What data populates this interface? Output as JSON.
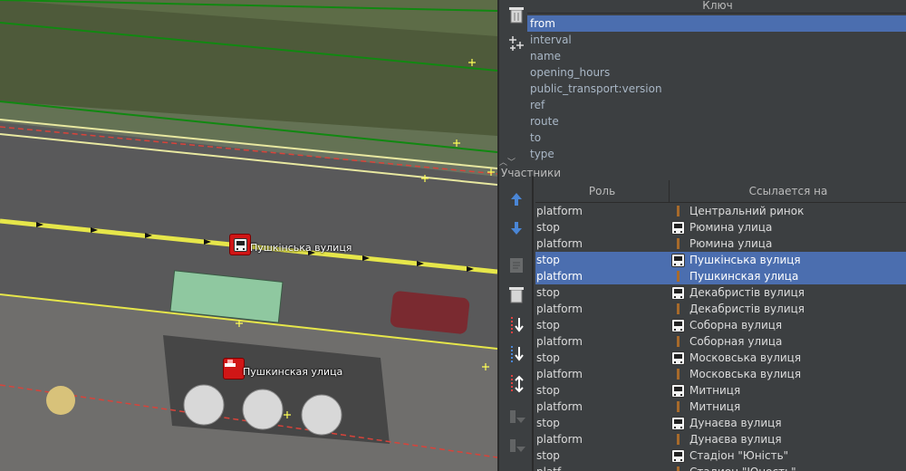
{
  "map": {
    "labels": {
      "stop_top": "Пушкінська вулиця",
      "stop_bottom": "Пушкинская улица"
    }
  },
  "tags": {
    "header": "Ключ",
    "keys": [
      "from",
      "interval",
      "name",
      "opening_hours",
      "public_transport:version",
      "ref",
      "route",
      "to",
      "type"
    ],
    "selected_index": 0
  },
  "members": {
    "title": "Участники",
    "col_role": "Роль",
    "col_ref": "Ссылается на",
    "rows": [
      {
        "role": "platform",
        "icon": "platform-icon",
        "ref": "Центральний ринок",
        "selected": false
      },
      {
        "role": "stop",
        "icon": "bus-stop-icon",
        "ref": "Рюмина улица",
        "selected": false
      },
      {
        "role": "platform",
        "icon": "platform-icon",
        "ref": "Рюмина улица",
        "selected": false
      },
      {
        "role": "stop",
        "icon": "bus-stop-icon",
        "ref": "Пушкінська вулиця",
        "selected": true
      },
      {
        "role": "platform",
        "icon": "platform-icon",
        "ref": "Пушкинская улица",
        "selected": true
      },
      {
        "role": "stop",
        "icon": "bus-stop-icon",
        "ref": "Декабристів вулиця",
        "selected": false
      },
      {
        "role": "platform",
        "icon": "platform-icon",
        "ref": "Декабристів вулиця",
        "selected": false
      },
      {
        "role": "stop",
        "icon": "bus-stop-icon",
        "ref": "Соборна вулиця",
        "selected": false
      },
      {
        "role": "platform",
        "icon": "platform-icon",
        "ref": "Соборная улица",
        "selected": false
      },
      {
        "role": "stop",
        "icon": "bus-stop-icon",
        "ref": "Московська вулиця",
        "selected": false
      },
      {
        "role": "platform",
        "icon": "platform-icon",
        "ref": "Московська вулиця",
        "selected": false
      },
      {
        "role": "stop",
        "icon": "bus-stop-icon",
        "ref": "Митниця",
        "selected": false
      },
      {
        "role": "platform",
        "icon": "platform-icon",
        "ref": "Митниця",
        "selected": false
      },
      {
        "role": "stop",
        "icon": "bus-stop-icon",
        "ref": "Дунаєва вулиця",
        "selected": false
      },
      {
        "role": "platform",
        "icon": "platform-icon",
        "ref": "Дунаєва вулиця",
        "selected": false
      },
      {
        "role": "stop",
        "icon": "bus-stop-icon",
        "ref": "Стадіон \"Юність\"",
        "selected": false
      },
      {
        "role": "platf",
        "icon": "platform-icon",
        "ref": "Стадион \"Юность\"",
        "selected": false
      }
    ]
  },
  "colors": {
    "selection": "#4b6eaf",
    "route_line": "#e6e64a",
    "stop_marker": "#d01616",
    "way_green": "#118811",
    "dashed_red": "#d8433a"
  }
}
